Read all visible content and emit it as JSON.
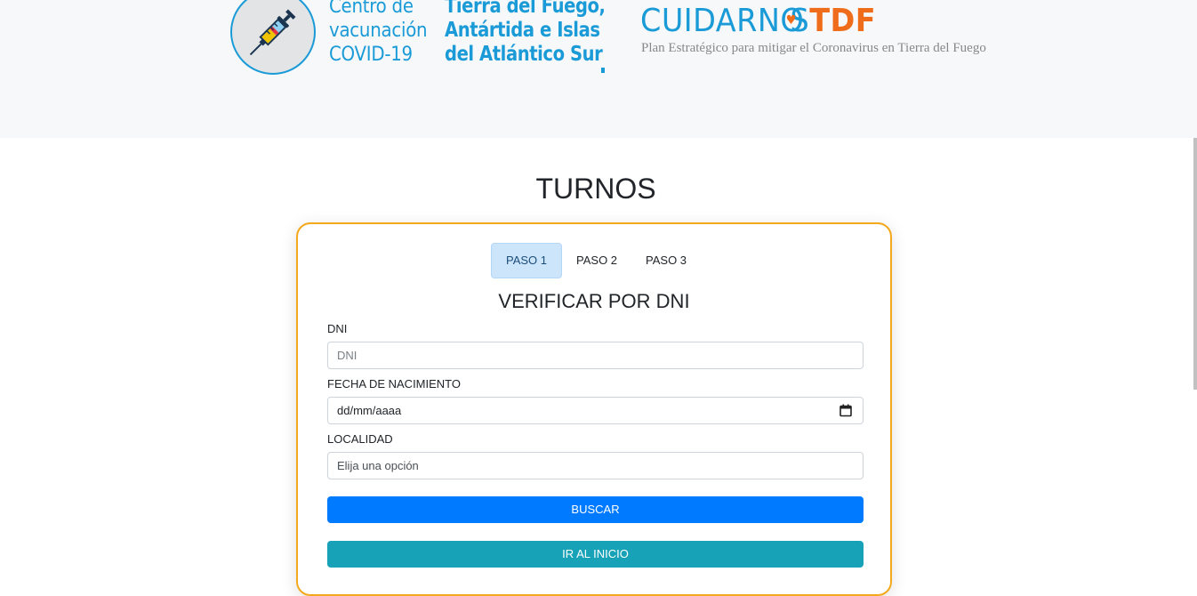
{
  "header": {
    "vac_lines": [
      "Centro de",
      "vacunación",
      "COVID-19"
    ],
    "province_lines": [
      "Tierra del Fuego,",
      "Antártida e Islas",
      "del Atlántico Sur"
    ],
    "brand_main": "CUIDARN",
    "brand_o": "O",
    "brand_end": "S",
    "brand_accent": "TDF",
    "tagline": "Plan Estratégico para mitigar el Coronavirus en Tierra del Fuego",
    "colors": {
      "brand_blue": "#1a9bd7",
      "brand_orange": "#ef6c1b"
    }
  },
  "page": {
    "title": "TURNOS"
  },
  "wizard": {
    "tabs": [
      {
        "label": "PASO 1",
        "active": true
      },
      {
        "label": "PASO 2",
        "active": false
      },
      {
        "label": "PASO 3",
        "active": false
      }
    ],
    "step_title": "VERIFICAR POR DNI"
  },
  "form": {
    "dni": {
      "label": "DNI",
      "placeholder": "DNI"
    },
    "birthdate": {
      "label": "FECHA DE NACIMIENTO",
      "placeholder": "dd/mm/aaaa",
      "icon": "calendar-icon"
    },
    "locality": {
      "label": "LOCALIDAD",
      "value": "Elija una opción"
    },
    "search_button": "BUSCAR",
    "home_button": "IR AL INICIO"
  },
  "colors": {
    "card_border": "#f4a81d",
    "primary": "#007bff",
    "info": "#17a2b8"
  }
}
